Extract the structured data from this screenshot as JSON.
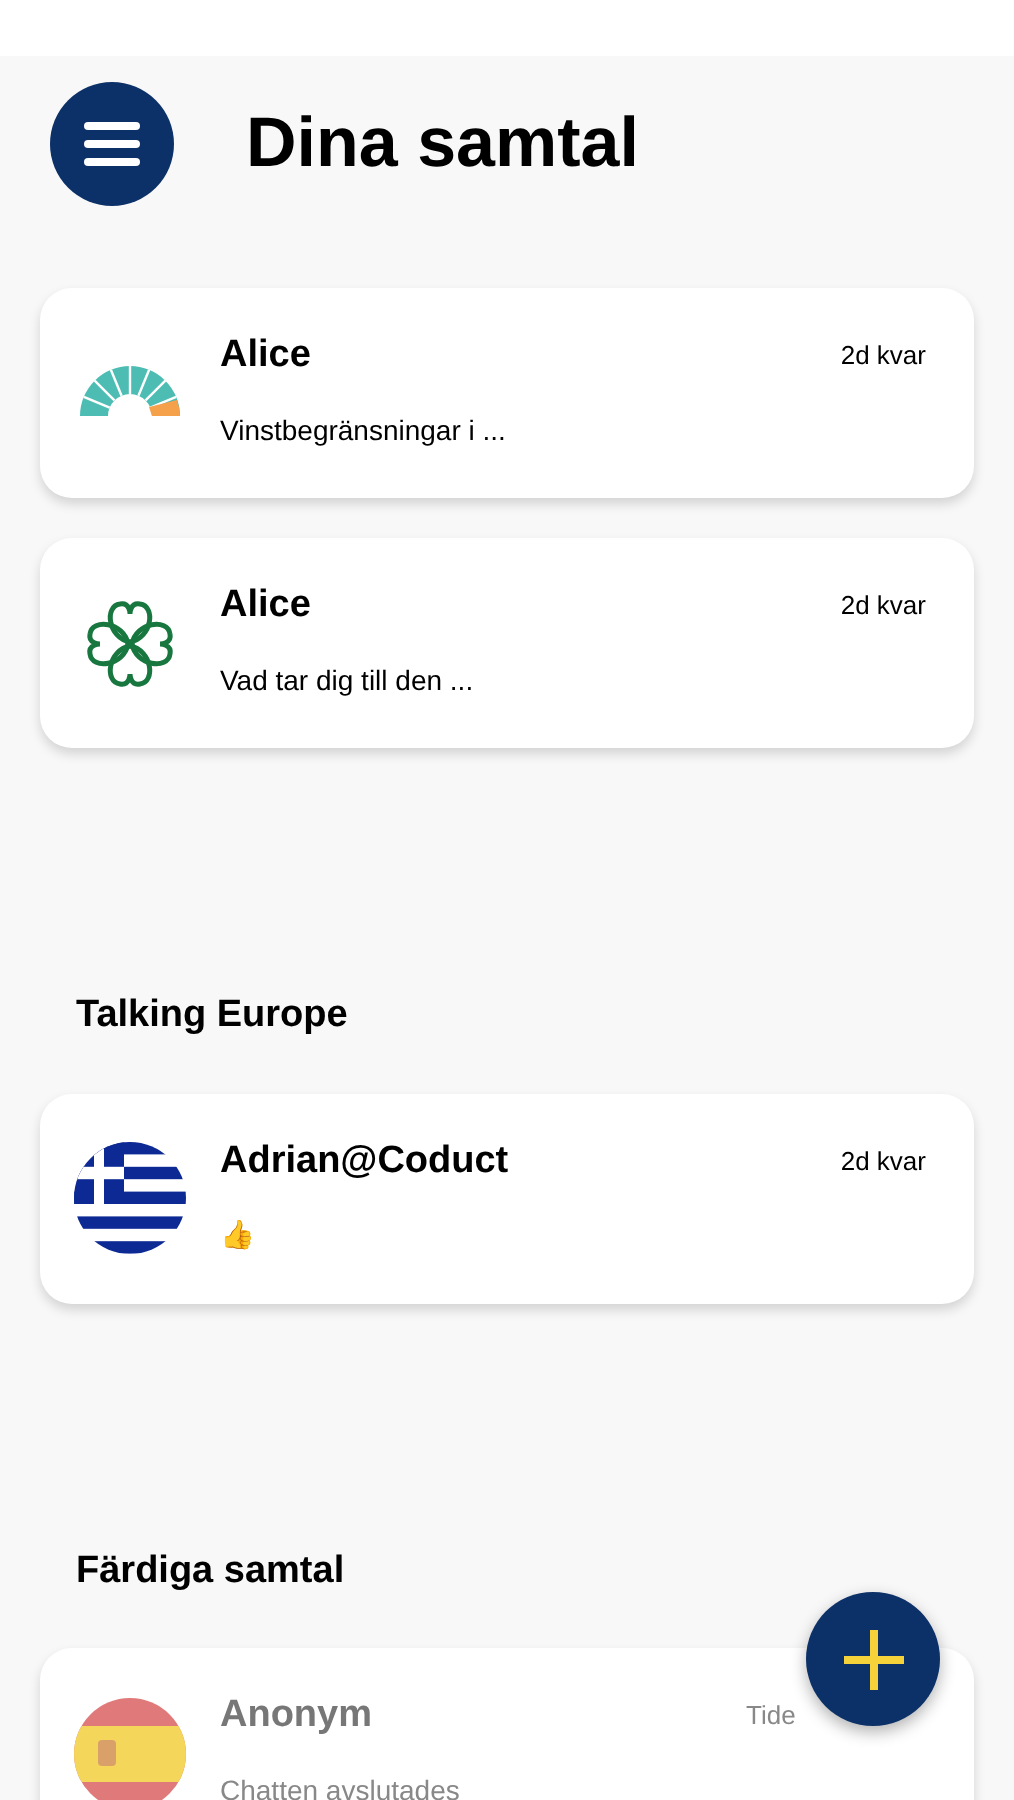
{
  "header": {
    "title": "Dina samtal"
  },
  "groups": [
    {
      "conversations": [
        {
          "avatar": {
            "kind": "fan"
          },
          "name": "Alice",
          "time": "2d kvar",
          "preview": "Vinstbegränsningar i ...",
          "ended": false
        },
        {
          "avatar": {
            "kind": "clover"
          },
          "name": "Alice",
          "time": "2d kvar",
          "preview": "Vad tar dig till den ...",
          "ended": false
        }
      ]
    },
    {
      "title": "Talking Europe",
      "conversations": [
        {
          "avatar": {
            "kind": "greece"
          },
          "name": "Adrian@Coduct",
          "time": "2d kvar",
          "preview": "👍",
          "ended": false
        }
      ]
    },
    {
      "title": "Färdiga samtal",
      "conversations": [
        {
          "avatar": {
            "kind": "spain"
          },
          "name": "Anonym",
          "time": "Tide",
          "preview": "Chatten avslutades",
          "ended": true
        }
      ]
    }
  ]
}
